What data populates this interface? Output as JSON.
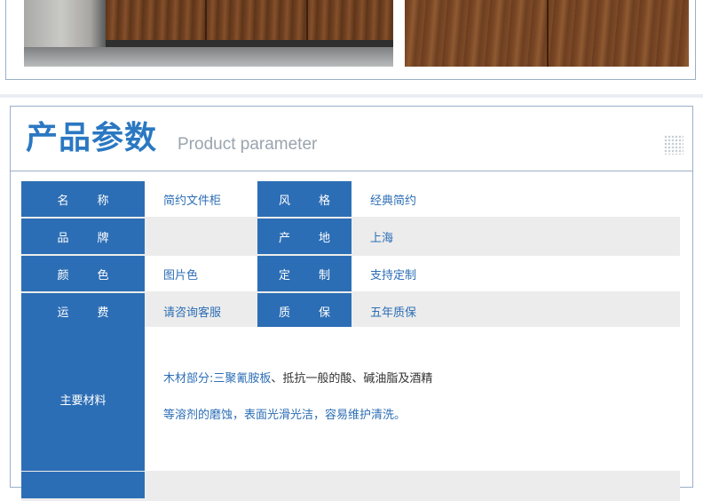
{
  "header": {
    "title_cn": "产品参数",
    "title_en": "Product parameter"
  },
  "params": [
    {
      "l1": [
        "名",
        "称"
      ],
      "v1": "简约文件柜",
      "l2": [
        "风",
        "格"
      ],
      "v2": "经典简约"
    },
    {
      "l1": [
        "品",
        "牌"
      ],
      "v1": "",
      "l2": [
        "产",
        "地"
      ],
      "v2": "上海"
    },
    {
      "l1": [
        "颜",
        "色"
      ],
      "v1": "图片色",
      "l2": [
        "定",
        "制"
      ],
      "v2": "支持定制"
    },
    {
      "l1": [
        "运",
        "费"
      ],
      "v1": "请咨询客服",
      "l2": [
        "质",
        "保"
      ],
      "v2": "五年质保"
    }
  ],
  "material": {
    "label": "主要材料",
    "line1_blue": "木材部分:三聚氰胺板",
    "line1_dark": "、抵抗一般的酸、碱油脂及酒精",
    "line2": "等溶剂的磨蚀，表面光滑光洁，容易维护清洗。"
  },
  "colors": {
    "accent": "#2c6eb5",
    "title": "#2b78c2",
    "border": "#9ab0c8"
  }
}
